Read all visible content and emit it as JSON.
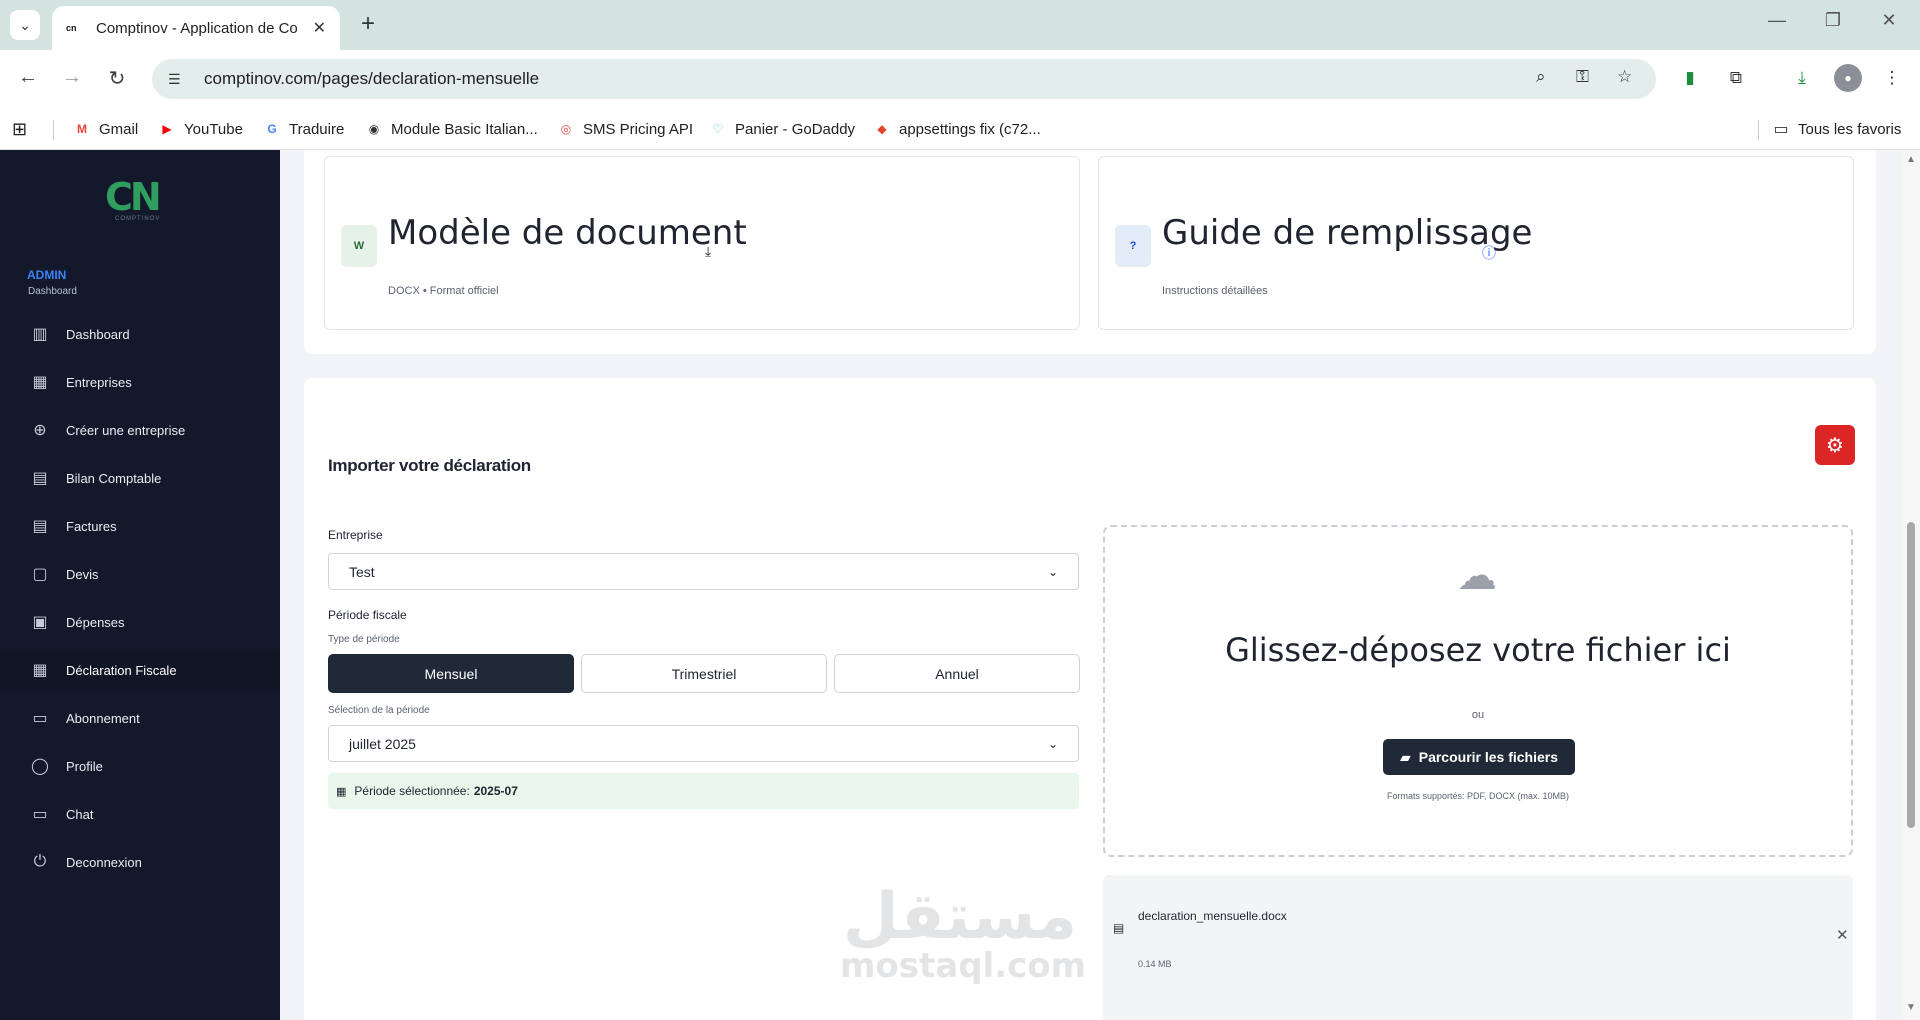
{
  "browser": {
    "tab_title": "Comptinov - Application de Co",
    "tab_favicon": "cn",
    "url": "comptinov.com/pages/declaration-mensuelle",
    "bookmarks": [
      {
        "label": "Gmail",
        "icon": "gmail-icon",
        "glyph": "M",
        "color": "#ea4335"
      },
      {
        "label": "YouTube",
        "icon": "youtube-icon",
        "glyph": "▶",
        "color": "#ff0000"
      },
      {
        "label": "Traduire",
        "icon": "translate-icon",
        "glyph": "G",
        "color": "#4285f4"
      },
      {
        "label": "Module Basic Italian...",
        "icon": "globe-icon",
        "glyph": "◉",
        "color": "#333333"
      },
      {
        "label": "SMS Pricing API",
        "icon": "target-icon",
        "glyph": "◎",
        "color": "#e0483b"
      },
      {
        "label": "Panier - GoDaddy",
        "icon": "godaddy-icon",
        "glyph": "♡",
        "color": "#1bbcd4"
      },
      {
        "label": "appsettings fix (c72...",
        "icon": "gitlab-icon",
        "glyph": "◆",
        "color": "#e24329"
      }
    ],
    "all_bookmarks_label": "Tous les favoris"
  },
  "sidebar": {
    "logo_text": "CN",
    "logo_subtext": "COMPTINOV",
    "role": "ADMIN",
    "role_sub": "Dashboard",
    "items": [
      {
        "label": "Dashboard",
        "icon": "chart-bars-icon",
        "glyph": "▥"
      },
      {
        "label": "Entreprises",
        "icon": "building-icon",
        "glyph": "▦"
      },
      {
        "label": "Créer une entreprise",
        "icon": "plus-circle-icon",
        "glyph": "⊕"
      },
      {
        "label": "Bilan Comptable",
        "icon": "document-chart-icon",
        "glyph": "▤"
      },
      {
        "label": "Factures",
        "icon": "invoice-icon",
        "glyph": "▤"
      },
      {
        "label": "Devis",
        "icon": "file-icon",
        "glyph": "▢"
      },
      {
        "label": "Dépenses",
        "icon": "money-icon",
        "glyph": "▣"
      },
      {
        "label": "Déclaration Fiscale",
        "icon": "calendar-icon",
        "glyph": "▦"
      },
      {
        "label": "Abonnement",
        "icon": "credit-card-icon",
        "glyph": "▭"
      },
      {
        "label": "Profile",
        "icon": "user-icon",
        "glyph": "◯"
      },
      {
        "label": "Chat",
        "icon": "chat-icon",
        "glyph": "▭"
      },
      {
        "label": "Deconnexion",
        "icon": "power-icon",
        "glyph": "⏻"
      }
    ],
    "active_index": 7
  },
  "resources": {
    "template": {
      "title": "Modèle de document",
      "subtitle": "DOCX • Format officiel",
      "icon_glyph": "W"
    },
    "guide": {
      "title": "Guide de remplissage",
      "subtitle": "Instructions détaillées",
      "icon_glyph": "?"
    }
  },
  "import": {
    "title": "Importer votre déclaration",
    "company_label": "Entreprise",
    "company_value": "Test",
    "period_label": "Période fiscale",
    "period_type_label": "Type de période",
    "period_types": [
      "Mensuel",
      "Trimestriel",
      "Annuel"
    ],
    "period_type_selected": "Mensuel",
    "period_select_label": "Sélection de la période",
    "period_select_value": "juillet 2025",
    "selected_period_prefix": "Période sélectionnée:",
    "selected_period_value": "2025-07"
  },
  "dropzone": {
    "title": "Glissez-déposez votre fichier ici",
    "or": "ou",
    "browse_label": "Parcourir les fichiers",
    "formats": "Formats supportés: PDF, DOCX (max. 10MB)"
  },
  "uploaded_file": {
    "name": "declaration_mensuelle.docx",
    "size": "0.14 MB"
  },
  "watermark": {
    "arabic": "مستقل",
    "latin": "mostaql.com"
  },
  "colors": {
    "accent_dark": "#1f2937",
    "danger": "#dc2626",
    "sidebar_bg": "#13192b",
    "admin_blue": "#3b82f6",
    "logo_green": "#2f9e5e"
  }
}
